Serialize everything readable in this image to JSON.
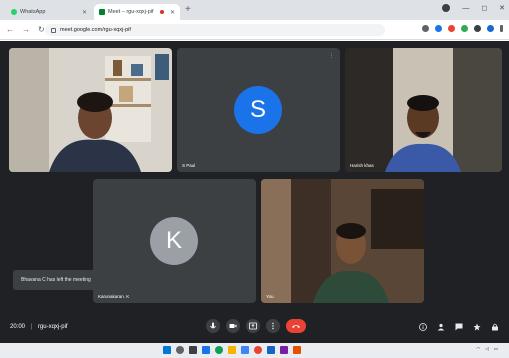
{
  "browser": {
    "tabs": [
      {
        "label": "WhatsApp",
        "active": false
      },
      {
        "label": "Meet – rgu-xqxj-pif",
        "active": true
      }
    ],
    "url": "meet.google.com/rgu-xqxj-pif"
  },
  "meet": {
    "participants": [
      {
        "name": "",
        "kind": "video"
      },
      {
        "name": "S Paul",
        "kind": "avatar",
        "initial": "S",
        "color": "#1a73e8"
      },
      {
        "name": "Harish khas",
        "kind": "video"
      },
      {
        "name": "Karunakaran. K",
        "kind": "avatar",
        "initial": "K",
        "color": "#9aa0a6"
      },
      {
        "name": "You",
        "kind": "video"
      }
    ],
    "toast": "Bhavana C has left the meeting",
    "time": "20:00",
    "meeting_code": "rgu-xqxj-pif",
    "controls": [
      "mic-icon",
      "camera-icon",
      "present-icon",
      "more-icon",
      "end-call-icon"
    ],
    "right_controls": [
      "info-icon",
      "people-icon",
      "chat-icon",
      "activities-icon",
      "lock-icon"
    ]
  },
  "taskbar": {
    "clock_time": "",
    "clock_date": ""
  }
}
